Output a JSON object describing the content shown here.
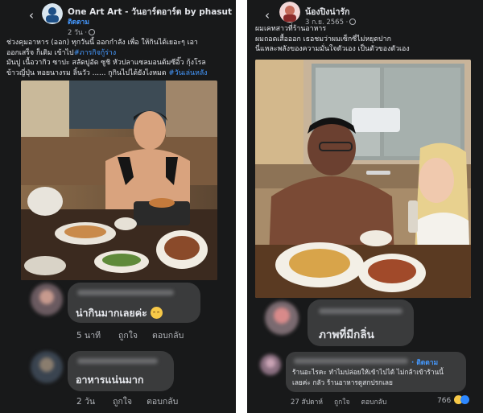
{
  "left_post": {
    "page_name": "One Art Art - วันอาร์ตอาร์ต by phasut",
    "follow_label": "ติดตาม",
    "timestamp": "2 วัน ·",
    "caption_lines": [
      "ช่วงคุมอาหาร (ออก) ทุกวันนี้ ออกกำลัง เพื่อ ให้กินได้เยอะๆ เอา",
      "ออกเสร็จ ก็เติม เข้าไป",
      "มันปู เนื้อวากิว ซาปะ สลัดปูอัด ซูชิ หัวปลาแซลมอนต้มซีอิ๊ว กุ้งโรล",
      "ข้าวญี่ปุ่น หอยนางรม ลิ้นวัว ...... กูกินไปได้ยังไงหมด "
    ],
    "hashtags": [
      "#ภารกิจกู้ร่าง",
      "#วันเล่นหลัง"
    ],
    "comments": [
      {
        "text": "น่ากินมากเลยค่ะ",
        "time": "5 นาที",
        "like": "ถูกใจ",
        "reply": "ตอบกลับ",
        "emoji": "smiling-face-icon"
      },
      {
        "text": "อาหารแน่นมาก",
        "time": "2 วัน",
        "like": "ถูกใจ",
        "reply": "ตอบกลับ"
      }
    ]
  },
  "right_post": {
    "page_name": "น้องปิงน่ารัก",
    "timestamp": "3 ก.ย. 2565 ·",
    "caption_lines": [
      "ผมเคทสาวที่ร้านอาหาร",
      "ผมถอดเสื้อออก เธอชมว่าผมเซ็กซี่ไม่หยุดปาก",
      "นี่แหละพลังของความมั่นใจตัวเอง เป็นตัวของตัวเอง"
    ],
    "comments": [
      {
        "text": "ภาพที่มีกลิ่น"
      },
      {
        "follow_label": "· ติดตาม",
        "text_lines": [
          "ร้านอะไรคะ ทำไมปล่อยให้เข้าไปได้ ไม่กล้าเข้าร้านนี้",
          "เลยค่ะ กลัว ร้านอาหารดูสกปรกเลย"
        ],
        "time": "27 สัปดาห์",
        "like": "ถูกใจ",
        "reply": "ตอบกลับ",
        "reaction_count": "766"
      }
    ]
  },
  "colors": {
    "background": "#18191a",
    "bubble": "#3a3b3c",
    "link_blue": "#4599ff",
    "secondary_text": "#b0b3b8"
  }
}
